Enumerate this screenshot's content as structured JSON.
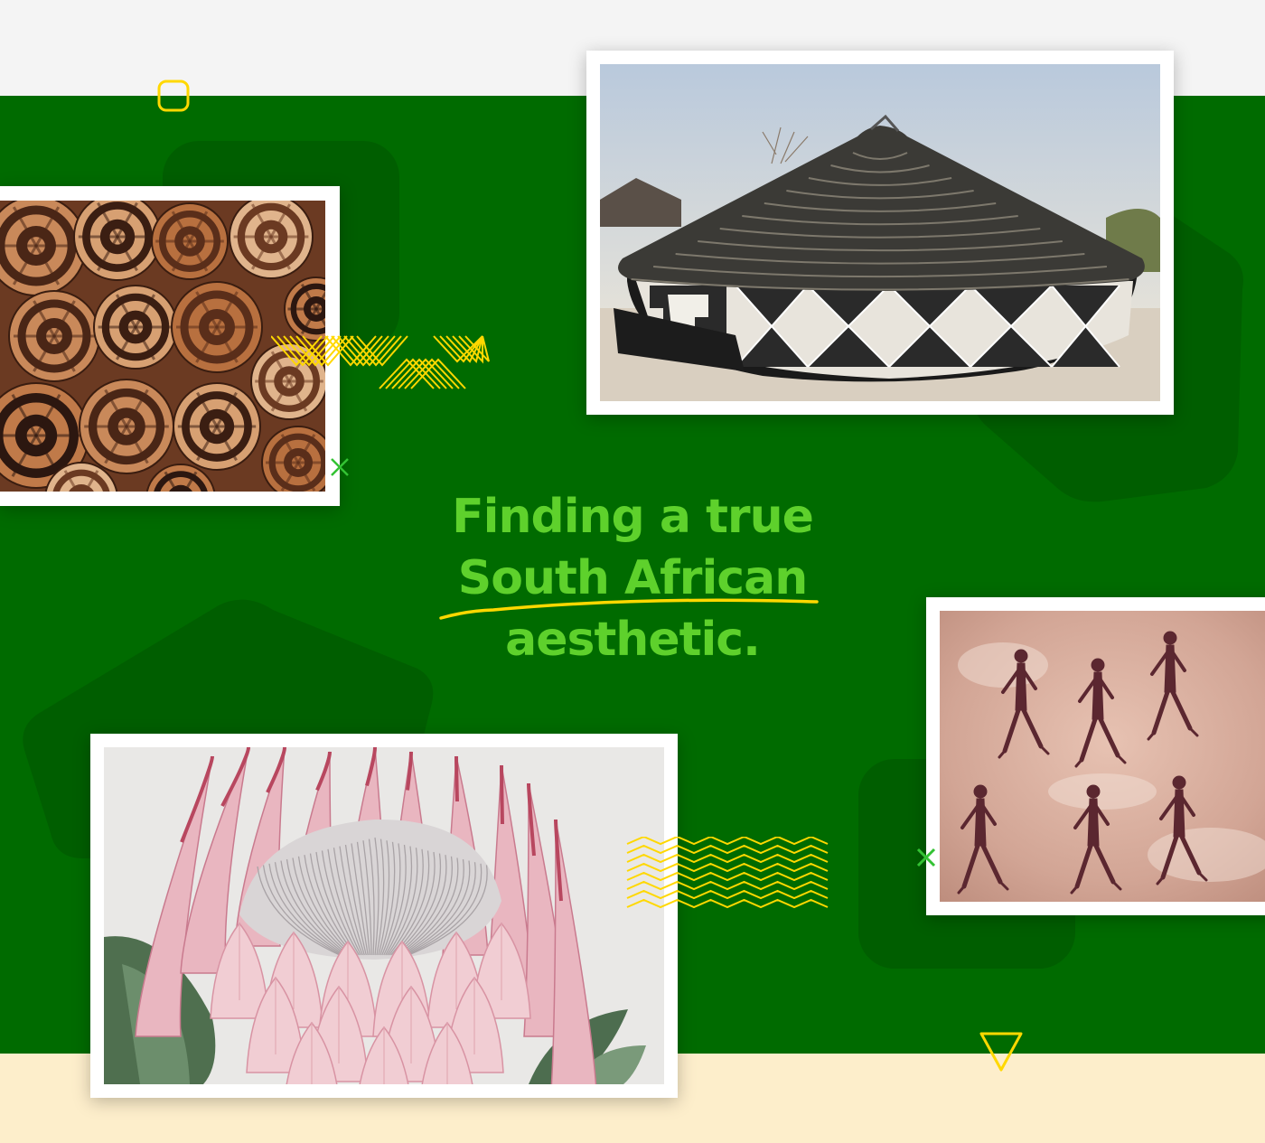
{
  "colors": {
    "top_background": "#f4f4f4",
    "green_band": "#006b00",
    "dark_green_shape": "#005e00",
    "cream_band": "#fdeecb",
    "headline_green": "#5ed12c",
    "accent_yellow": "#ffd800",
    "accent_green_x": "#33c233",
    "frame_white": "#ffffff"
  },
  "headline": {
    "line1": "Finding a true",
    "line2": "South African",
    "line3": "aesthetic."
  },
  "photos": [
    {
      "name": "woven-baskets-photo",
      "subject": "woven baskets"
    },
    {
      "name": "painted-rondavel-hut-photo",
      "subject": "thatched hut with geometric painted walls"
    },
    {
      "name": "rock-art-photo",
      "subject": "rock art of human figures"
    },
    {
      "name": "king-protea-flower-photo",
      "subject": "king protea flower"
    }
  ],
  "decorations": {
    "icons": [
      "rounded-square-outline-icon",
      "chevron-pattern-icon",
      "x-mark-icon",
      "zigzag-pattern-icon",
      "triangle-outline-icon"
    ]
  }
}
